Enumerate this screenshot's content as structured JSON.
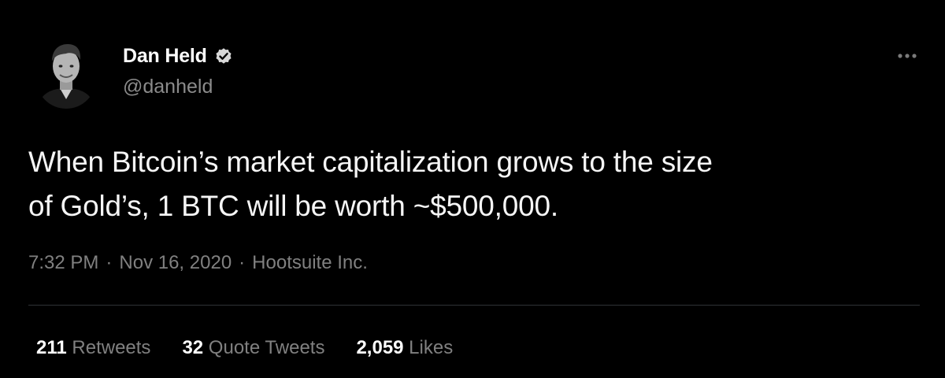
{
  "author": {
    "display_name": "Dan Held",
    "handle": "@danheld",
    "verified": true
  },
  "tweet": {
    "text_line1": "When Bitcoin’s market capitalization grows to the size",
    "text_line2": "of Gold’s, 1 BTC will be worth ~$500,000."
  },
  "meta": {
    "time": "7:32 PM",
    "date": "Nov 16, 2020",
    "source": "Hootsuite Inc.",
    "separator": "·"
  },
  "stats": {
    "retweets_count": "211",
    "retweets_label": " Retweets",
    "quotes_count": "32",
    "quotes_label": " Quote Tweets",
    "likes_count": "2,059",
    "likes_label": " Likes"
  },
  "colors": {
    "background": "#000000",
    "primary_text": "#ffffff",
    "secondary_text": "#808080",
    "divider": "#2f3336"
  },
  "icons": {
    "verified": "verified-badge-icon",
    "more": "more-options-icon",
    "avatar": "profile-photo"
  }
}
